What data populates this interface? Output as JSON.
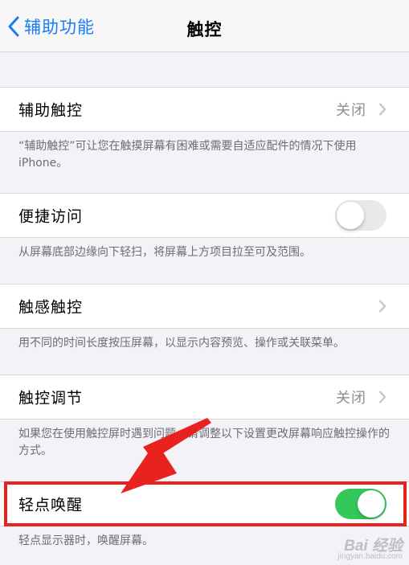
{
  "nav": {
    "back_label": "辅助功能",
    "title": "触控"
  },
  "rows": [
    {
      "label": "辅助触控",
      "value": "关闭",
      "footer": "“辅助触控”可让您在触摸屏幕有困难或需要自适应配件的情况下使用 iPhone。"
    },
    {
      "label": "便捷访问",
      "toggle": "off",
      "footer": "从屏幕底部边缘向下轻扫，将屏幕上方项目拉至可及范围。"
    },
    {
      "label": "触感触控",
      "footer": "用不同的时间长度按压屏幕，以显示内容预览、操作或关联菜单。"
    },
    {
      "label": "触控调节",
      "value": "关闭",
      "footer": "如果您在使用触控屏时遇到问题，请调整以下设置更改屏幕响应触控操作的方式。"
    },
    {
      "label": "轻点唤醒",
      "toggle": "on",
      "footer": "轻点显示器时，唤醒屏幕。"
    }
  ],
  "watermark": {
    "main": "Bai 经验",
    "sub": "jingyan.baidu.com"
  },
  "colors": {
    "accent": "#1a7cf5",
    "toggle_on": "#34c759",
    "annotation": "#e8231f"
  },
  "icons": {
    "back": "chevron-left-icon",
    "disclosure": "chevron-right-icon"
  }
}
